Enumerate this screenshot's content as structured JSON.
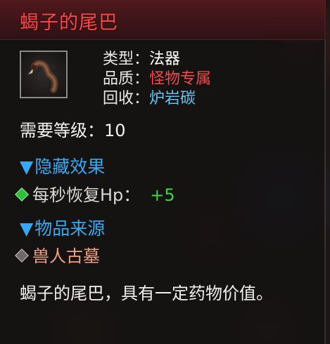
{
  "item": {
    "name": "蝎子的尾巴",
    "icon": "scorpion-tail-icon",
    "type_label": "类型",
    "type_value": "法器",
    "quality_label": "品质",
    "quality_value": "怪物专属",
    "recycle_label": "回收",
    "recycle_value": "炉岩碳",
    "colon": "：",
    "required_level_label": "需要等级：",
    "required_level_value": "10",
    "hidden_effect_header": "隐藏效果",
    "hidden_effect_name": "每秒恢复Hp：",
    "hidden_effect_value": "+5",
    "source_header": "物品来源",
    "source_value": "兽人古墓",
    "description": "蝎子的尾巴，具有一定药物价值。"
  },
  "colors": {
    "title": "#f24a4a",
    "quality": "#f24a4a",
    "recycle": "#67c2f0",
    "section_header": "#3aa8f0",
    "effect_value": "#46d146",
    "source": "#f0a080"
  },
  "section_marker": "▼"
}
